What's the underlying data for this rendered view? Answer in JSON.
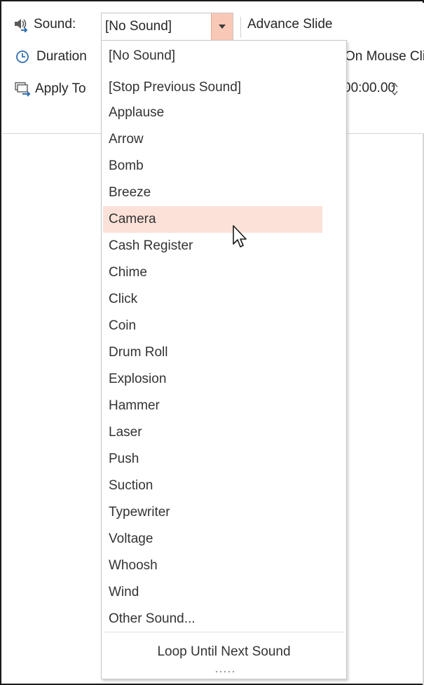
{
  "ribbon": {
    "sound_label": "Sound:",
    "duration_label": "Duration",
    "apply_label": "Apply To",
    "advance_label": "Advance Slide",
    "on_click_label": "On Mouse Click",
    "after_value": "00:00.00"
  },
  "sound_combo": {
    "selected": "[No Sound]"
  },
  "dropdown": {
    "items": [
      "[No Sound]",
      "[Stop Previous Sound]",
      "Applause",
      "Arrow",
      "Bomb",
      "Breeze",
      "Camera",
      "Cash Register",
      "Chime",
      "Click",
      "Coin",
      "Drum Roll",
      "Explosion",
      "Hammer",
      "Laser",
      "Push",
      "Suction",
      "Typewriter",
      "Voltage",
      "Whoosh",
      "Wind",
      "Other Sound..."
    ],
    "hovered_item": "Camera",
    "loop_label": "Loop Until Next Sound"
  },
  "colors": {
    "accent": "#f9c8b6",
    "hover": "#fbe1d8",
    "icon_blue": "#2e6fb0"
  }
}
